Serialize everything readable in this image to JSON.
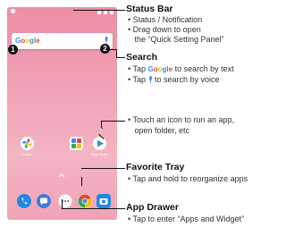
{
  "phone": {
    "search_logo": "Google",
    "badges": [
      "1",
      "2"
    ],
    "app_labels": [
      "Google",
      "",
      "Play Store"
    ]
  },
  "callouts": {
    "status_bar": {
      "title": "Status Bar",
      "lines": [
        "• Status / Notification",
        "• Drag down to open",
        "   the “Quick Setting Panel”"
      ]
    },
    "search": {
      "title": "Search",
      "line1_pre": "• Tap ",
      "line1_logo": "Google",
      "line1_post": " to search by text",
      "line2_pre": "• Tap ",
      "line2_post": " to search by voice"
    },
    "apps": {
      "lines": [
        "• Touch an icon to run an app,",
        "   open folder, etc"
      ]
    },
    "favorite_tray": {
      "title": "Favorite Tray",
      "lines": [
        "• Tap and hold to reorganize apps"
      ]
    },
    "app_drawer": {
      "title": "App Drawer",
      "lines": [
        "• Tap to enter “Apps and Widget”"
      ]
    }
  },
  "colors": {
    "wallpaper": "#f1a2b6",
    "google_blue": "#4285f4",
    "google_red": "#ea4335",
    "google_yellow": "#fbbc05",
    "google_green": "#34a853"
  }
}
